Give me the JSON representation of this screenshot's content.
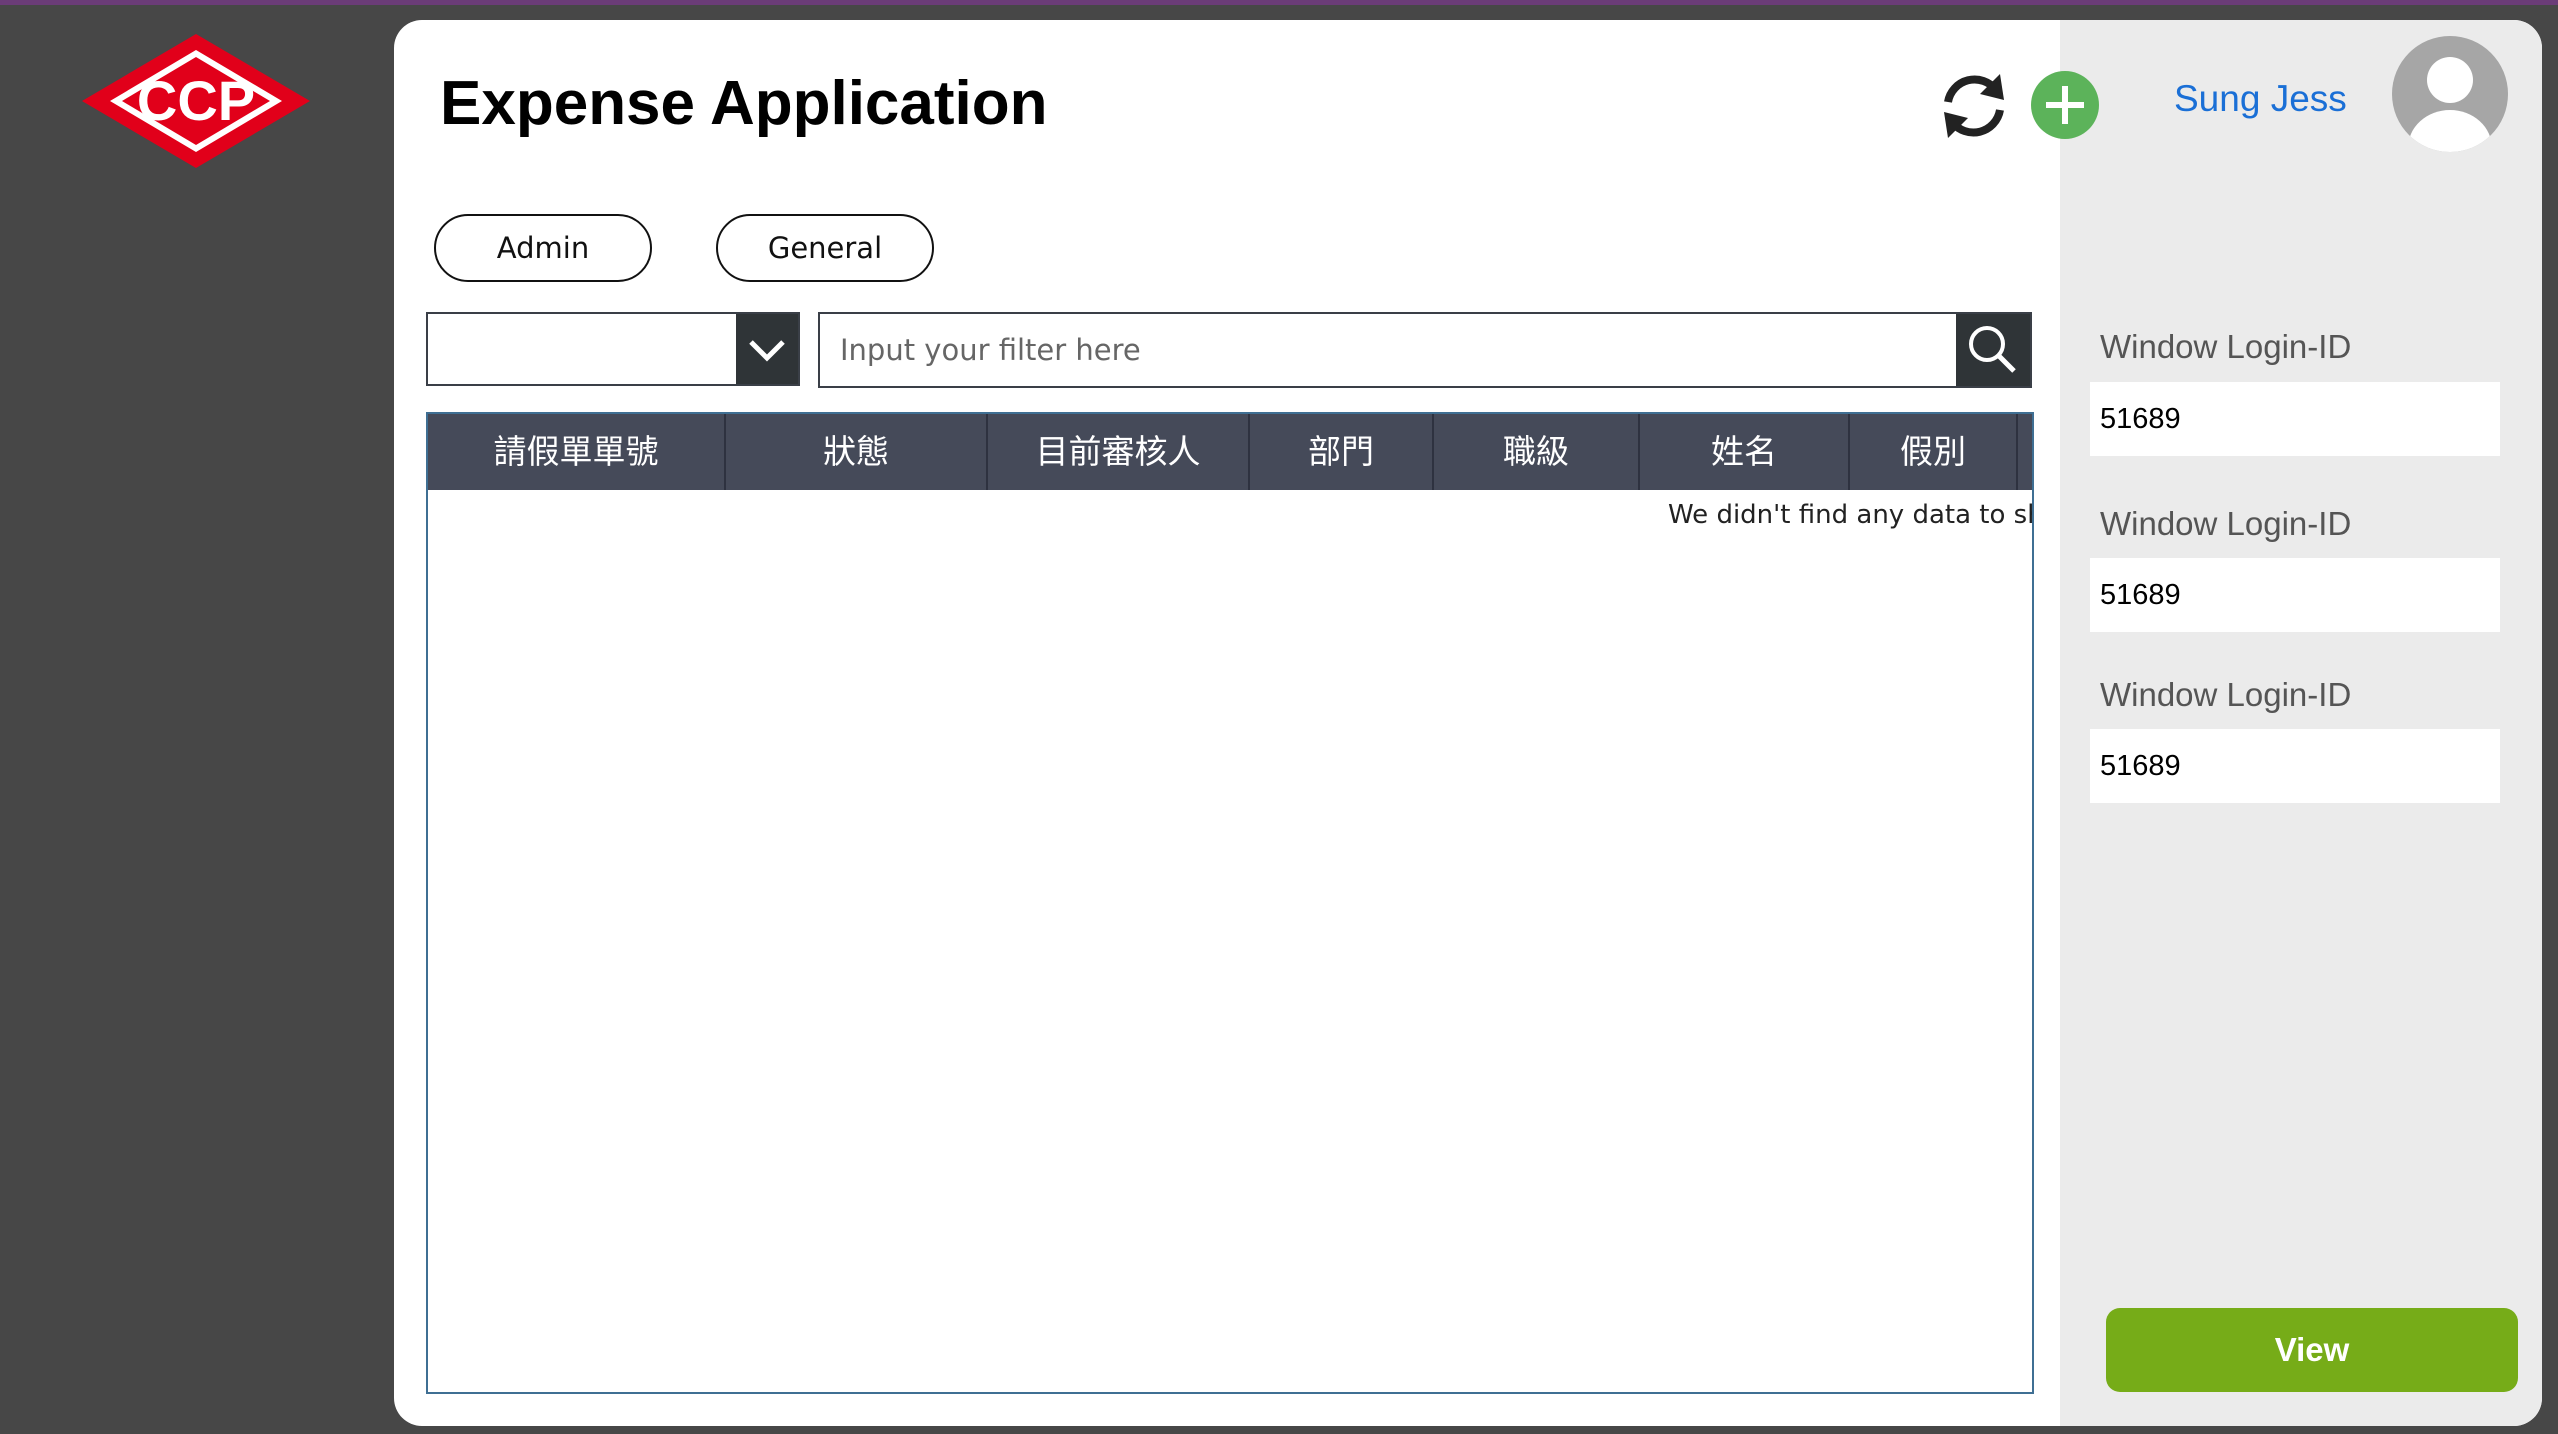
{
  "brand": {
    "logo_text": "CCP",
    "logo_color": "#e1001a"
  },
  "header": {
    "title": "Expense Application",
    "refresh_icon": "refresh-icon",
    "add_icon": "plus-circle-icon",
    "user_name": "Sung Jess",
    "avatar_icon": "user-avatar-icon"
  },
  "filters": {
    "admin_label": "Admin",
    "general_label": "General",
    "dropdown_value": "",
    "search_placeholder": "Input your filter here",
    "search_icon": "search-icon"
  },
  "table": {
    "columns": [
      "請假單單號",
      "狀態",
      "目前審核人",
      "部門",
      "職級",
      "姓名",
      "假別"
    ],
    "empty_message": "We didn't find any data to show"
  },
  "sidebar": {
    "fields": [
      {
        "label": "Window Login-ID",
        "value": "51689"
      },
      {
        "label": "Window Login-ID",
        "value": "51689"
      },
      {
        "label": "Window Login-ID",
        "value": "51689"
      }
    ],
    "view_label": "View"
  },
  "colors": {
    "background": "#474747",
    "header_row": "#454a59",
    "accent_green": "#76ac18",
    "add_green": "#5cb35a",
    "link_blue": "#1a6fd6"
  }
}
